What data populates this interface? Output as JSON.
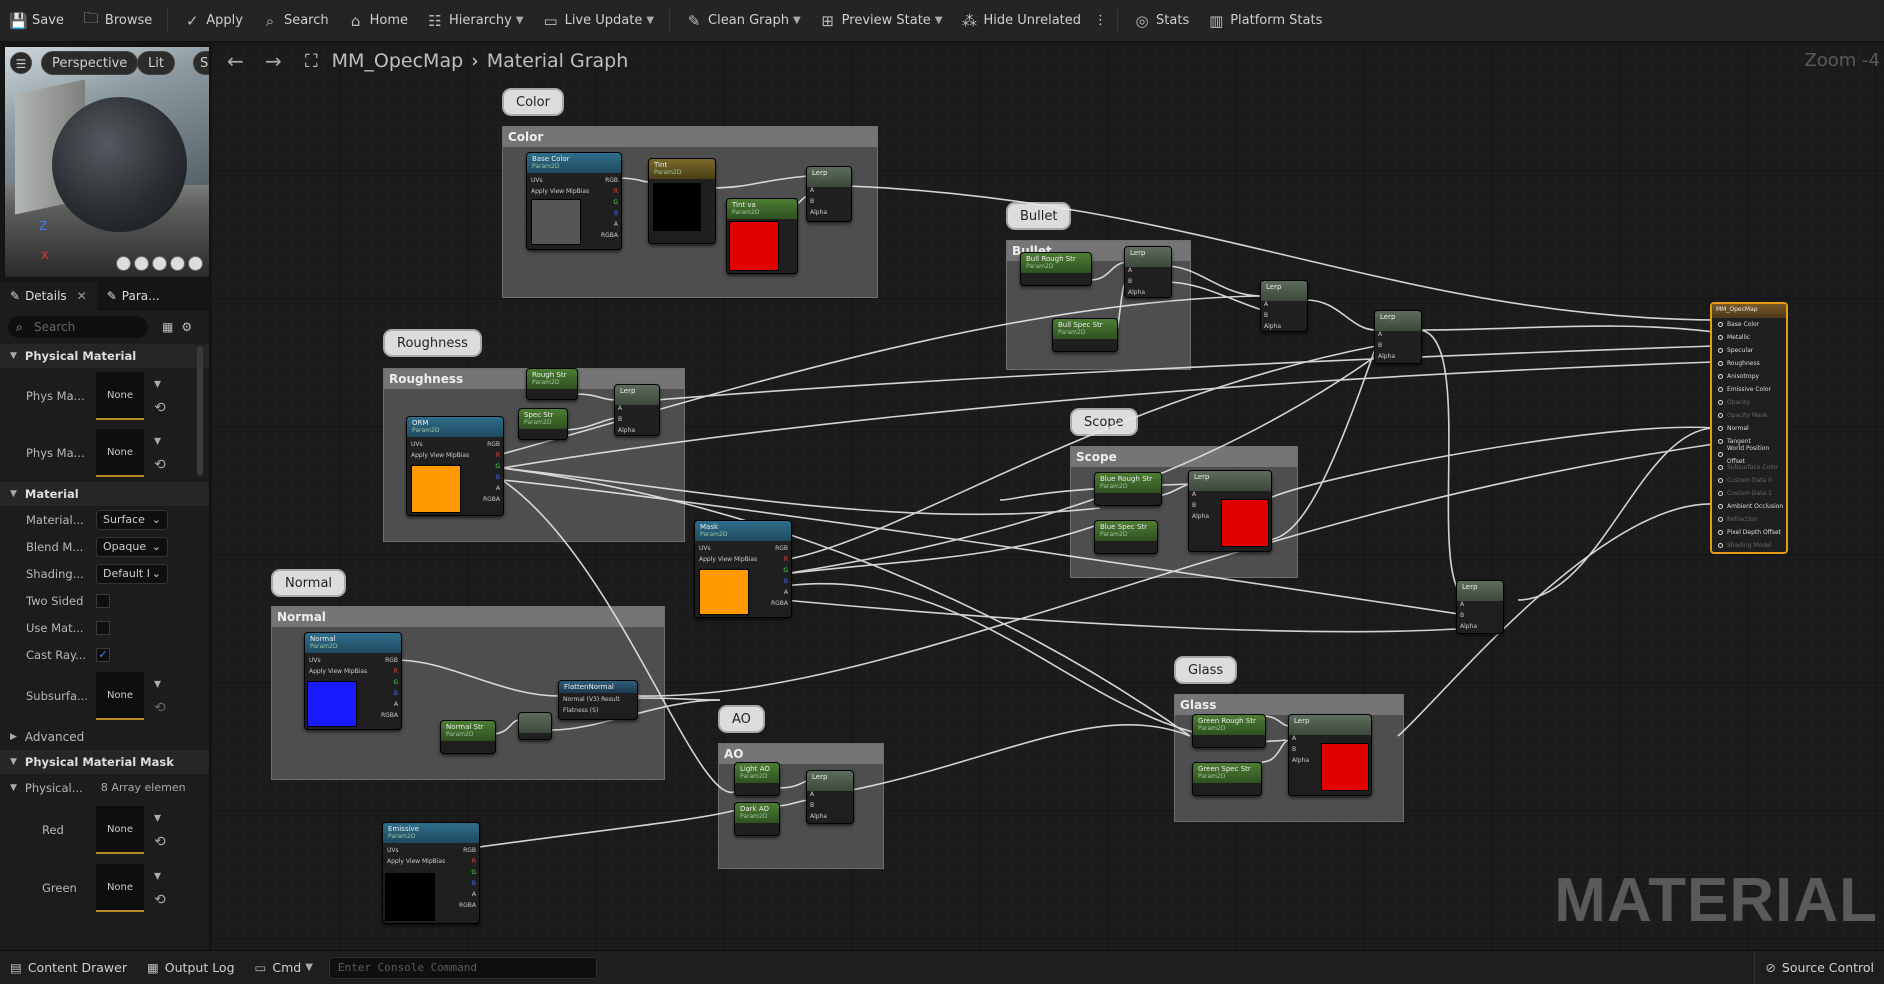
{
  "toolbar": {
    "save": "Save",
    "browse": "Browse",
    "apply": "Apply",
    "search": "Search",
    "home": "Home",
    "hierarchy": "Hierarchy",
    "live_update": "Live Update",
    "clean_graph": "Clean Graph",
    "preview_state": "Preview State",
    "hide_unrelated": "Hide Unrelated",
    "stats": "Stats",
    "platform_stats": "Platform Stats"
  },
  "viewport": {
    "perspective": "Perspective",
    "lit": "Lit",
    "sh": "Sh",
    "axis_z": "Z",
    "axis_x": "X"
  },
  "details": {
    "tab_details": "Details",
    "tab_params": "Para...",
    "search_placeholder": "Search",
    "physical_material": {
      "category": "Physical Material",
      "rows": [
        {
          "label": "Phys Ma...",
          "value": "None"
        },
        {
          "label": "Phys Ma...",
          "value": "None"
        }
      ]
    },
    "material": {
      "category": "Material",
      "material_domain": {
        "label": "Material...",
        "value": "Surface"
      },
      "blend_mode": {
        "label": "Blend M...",
        "value": "Opaque"
      },
      "shading_model": {
        "label": "Shading...",
        "value": "Default I"
      },
      "two_sided": {
        "label": "Two Sided",
        "checked": false
      },
      "use_mat": {
        "label": "Use Mat...",
        "checked": false
      },
      "cast_ray": {
        "label": "Cast Ray...",
        "checked": true
      },
      "subsurface": {
        "label": "Subsurfa...",
        "value": "None"
      },
      "advanced": "Advanced"
    },
    "physical_material_mask": {
      "category": "Physical Material Mask",
      "physical": {
        "label": "Physical...",
        "value": "8 Array elemen"
      },
      "red": {
        "label": "Red",
        "value": "None"
      },
      "green": {
        "label": "Green",
        "value": "None"
      }
    }
  },
  "graph": {
    "breadcrumb_asset": "MM_OpecMap",
    "breadcrumb_page": "Material Graph",
    "zoom": "Zoom -4",
    "watermark": "MATERIAL",
    "comments": {
      "color": "Color",
      "bullet": "Bullet",
      "roughness": "Roughness",
      "scope": "Scope",
      "normal": "Normal",
      "ao": "AO",
      "glass": "Glass"
    },
    "nodes": {
      "base_color": "Base Color",
      "param": "Param2D",
      "tint": "Tint",
      "tint_va": "Tint va",
      "lerp": "Lerp",
      "orm": "ORM",
      "rough_str": "Rough Str",
      "spec_str": "Spec Str",
      "mask": "Mask",
      "normal": "Normal",
      "normal_str": "Normal Str",
      "flatten_normal": "FlattenNormal",
      "emissive": "Emissive",
      "light_ao": "Light AO",
      "dark_ao": "Dark AO",
      "bull_rough": "Bull Rough Str",
      "bull_spec": "Bull Spec Str",
      "scope_rough": "Blue Rough Str",
      "scope_spec": "Blue Spec Str",
      "glass_rough": "Green Rough Str",
      "glass_spec": "Green Spec Str",
      "uvs": "UVs",
      "apply_mip": "Apply View MipBias",
      "pin_rgb": "RGB",
      "pin_r": "R",
      "pin_g": "G",
      "pin_b": "B",
      "pin_a": "A",
      "pin_rgba": "RGBA",
      "pin_alpha": "Alpha",
      "pin_normal_vs": "Normal (V3) Result",
      "pin_flatness": "Flatness (S)"
    },
    "output_node": {
      "title": "MM_OpecMap",
      "pins": [
        {
          "label": "Base Color",
          "active": true
        },
        {
          "label": "Metallic",
          "active": true
        },
        {
          "label": "Specular",
          "active": true
        },
        {
          "label": "Roughness",
          "active": true
        },
        {
          "label": "Anisotropy",
          "active": true
        },
        {
          "label": "Emissive Color",
          "active": true
        },
        {
          "label": "Opacity",
          "active": false
        },
        {
          "label": "Opacity Mask",
          "active": false
        },
        {
          "label": "Normal",
          "active": true
        },
        {
          "label": "Tangent",
          "active": true
        },
        {
          "label": "World Position Offset",
          "active": true
        },
        {
          "label": "Subsurface Color",
          "active": false
        },
        {
          "label": "Custom Data 0",
          "active": false
        },
        {
          "label": "Custom Data 1",
          "active": false
        },
        {
          "label": "Ambient Occlusion",
          "active": true
        },
        {
          "label": "Refraction",
          "active": false
        },
        {
          "label": "Pixel Depth Offset",
          "active": true
        },
        {
          "label": "Shading Model",
          "active": false
        }
      ]
    }
  },
  "bottombar": {
    "content_drawer": "Content Drawer",
    "output_log": "Output Log",
    "cmd": "Cmd",
    "console_placeholder": "Enter Console Command",
    "source_control": "Source Control"
  },
  "colors": {
    "accent": "#e79a16",
    "orange_swatch": "#ff9a00",
    "red_swatch": "#e00000",
    "blue_swatch": "#1a1aff"
  }
}
